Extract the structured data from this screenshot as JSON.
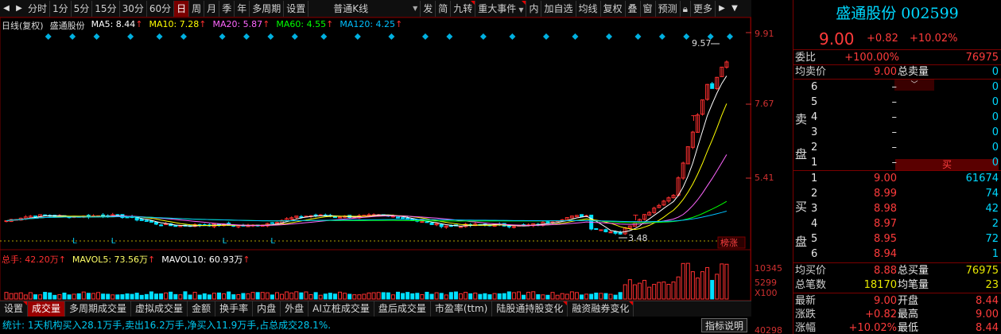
{
  "colors": {
    "up": "#ff3030",
    "down": "#00e0ff",
    "ma5": "#ffffff",
    "ma10": "#ffff00",
    "ma20": "#ff66ff",
    "ma60": "#00ff00",
    "ma120": "#00c0ff",
    "bg": "#000000"
  },
  "toolbar": {
    "periods": [
      "分时",
      "1分",
      "5分",
      "15分",
      "30分",
      "60分",
      "日",
      "周",
      "月",
      "季",
      "年",
      "多周期",
      "设置"
    ],
    "active_period": "日",
    "kline_type": "普通K线",
    "tools": [
      "发",
      "简",
      "九转",
      "重大事件",
      "内",
      "加自选",
      "均线",
      "复权",
      "叠",
      "窗",
      "预测"
    ],
    "more": "更多"
  },
  "legend": {
    "name": "日线(复权)",
    "stock": "盛通股份",
    "ma5": "MA5: 8.44",
    "ma10": "MA10: 7.28",
    "ma20": "MA20: 5.87",
    "ma60": "MA60: 4.55",
    "ma120": "MA120: 4.25",
    "arrow": "↑"
  },
  "vol_legend": {
    "total": "总手: 42.20万",
    "mavol5": "MAVOL5: 73.56万",
    "mavol10": "MAVOL10: 60.93万",
    "arrow": "↑"
  },
  "axis": {
    "p1": "9.91",
    "p2": "7.67",
    "p3": "5.41",
    "v1": "10345",
    "v2": "5299",
    "v3": "X100",
    "v4": "40298"
  },
  "annotations": {
    "high": "9.57",
    "low": "3.48",
    "bang": "榜涨",
    "l_marker": "L",
    "t_marker": "T"
  },
  "tabs": [
    "设置",
    "成交量",
    "多周期成交量",
    "虚拟成交量",
    "金额",
    "换手率",
    "内盘",
    "外盘",
    "AI立桩成交量",
    "盘后成交量",
    "市盈率(ttm)",
    "陆股通持股变化",
    "融资融券变化"
  ],
  "active_tab": "成交量",
  "stats": "统计: 1天机构买入28.1万手,卖出16.2万手,净买入11.9万手,占总成交28.1%.",
  "indicator_btn": "指标说明",
  "quote": {
    "title": "盛通股份 002599",
    "price": "9.00",
    "change": "+0.82",
    "pct": "+10.02%",
    "weibi_label": "委比",
    "weibi": "+100.00%",
    "weicha": "76975",
    "avg_sell_label": "均卖价",
    "avg_sell": "9.00",
    "total_sell_label": "总卖量",
    "total_sell": "0",
    "sell_side": "卖盘",
    "buy_side": "买盘",
    "buy_tag": "买",
    "sells": [
      {
        "n": "6",
        "p": "–",
        "v": "0"
      },
      {
        "n": "5",
        "p": "–",
        "v": "0"
      },
      {
        "n": "4",
        "p": "–",
        "v": "0"
      },
      {
        "n": "3",
        "p": "–",
        "v": "0"
      },
      {
        "n": "2",
        "p": "–",
        "v": "0"
      },
      {
        "n": "1",
        "p": "–",
        "v": "0"
      }
    ],
    "buys": [
      {
        "n": "1",
        "p": "9.00",
        "v": "61674"
      },
      {
        "n": "2",
        "p": "8.99",
        "v": "74"
      },
      {
        "n": "3",
        "p": "8.98",
        "v": "42"
      },
      {
        "n": "4",
        "p": "8.97",
        "v": "2"
      },
      {
        "n": "5",
        "p": "8.95",
        "v": "72"
      },
      {
        "n": "6",
        "p": "8.94",
        "v": "1"
      }
    ],
    "avg_buy_label": "均买价",
    "avg_buy": "8.88",
    "total_buy_label": "总买量",
    "total_buy": "76975",
    "total_orders_label": "总笔数",
    "total_orders": "18170",
    "avg_vol_label": "均笔量",
    "avg_vol": "23",
    "latest_label": "最新",
    "latest": "9.00",
    "open_label": "开盘",
    "open": "8.44",
    "chg_label": "涨跌",
    "chg": "+0.82",
    "high_label": "最高",
    "high": "9.00",
    "pct_label": "涨幅",
    "pct2": "+10.02%",
    "low_label": "最低",
    "low": "8.44"
  }
}
